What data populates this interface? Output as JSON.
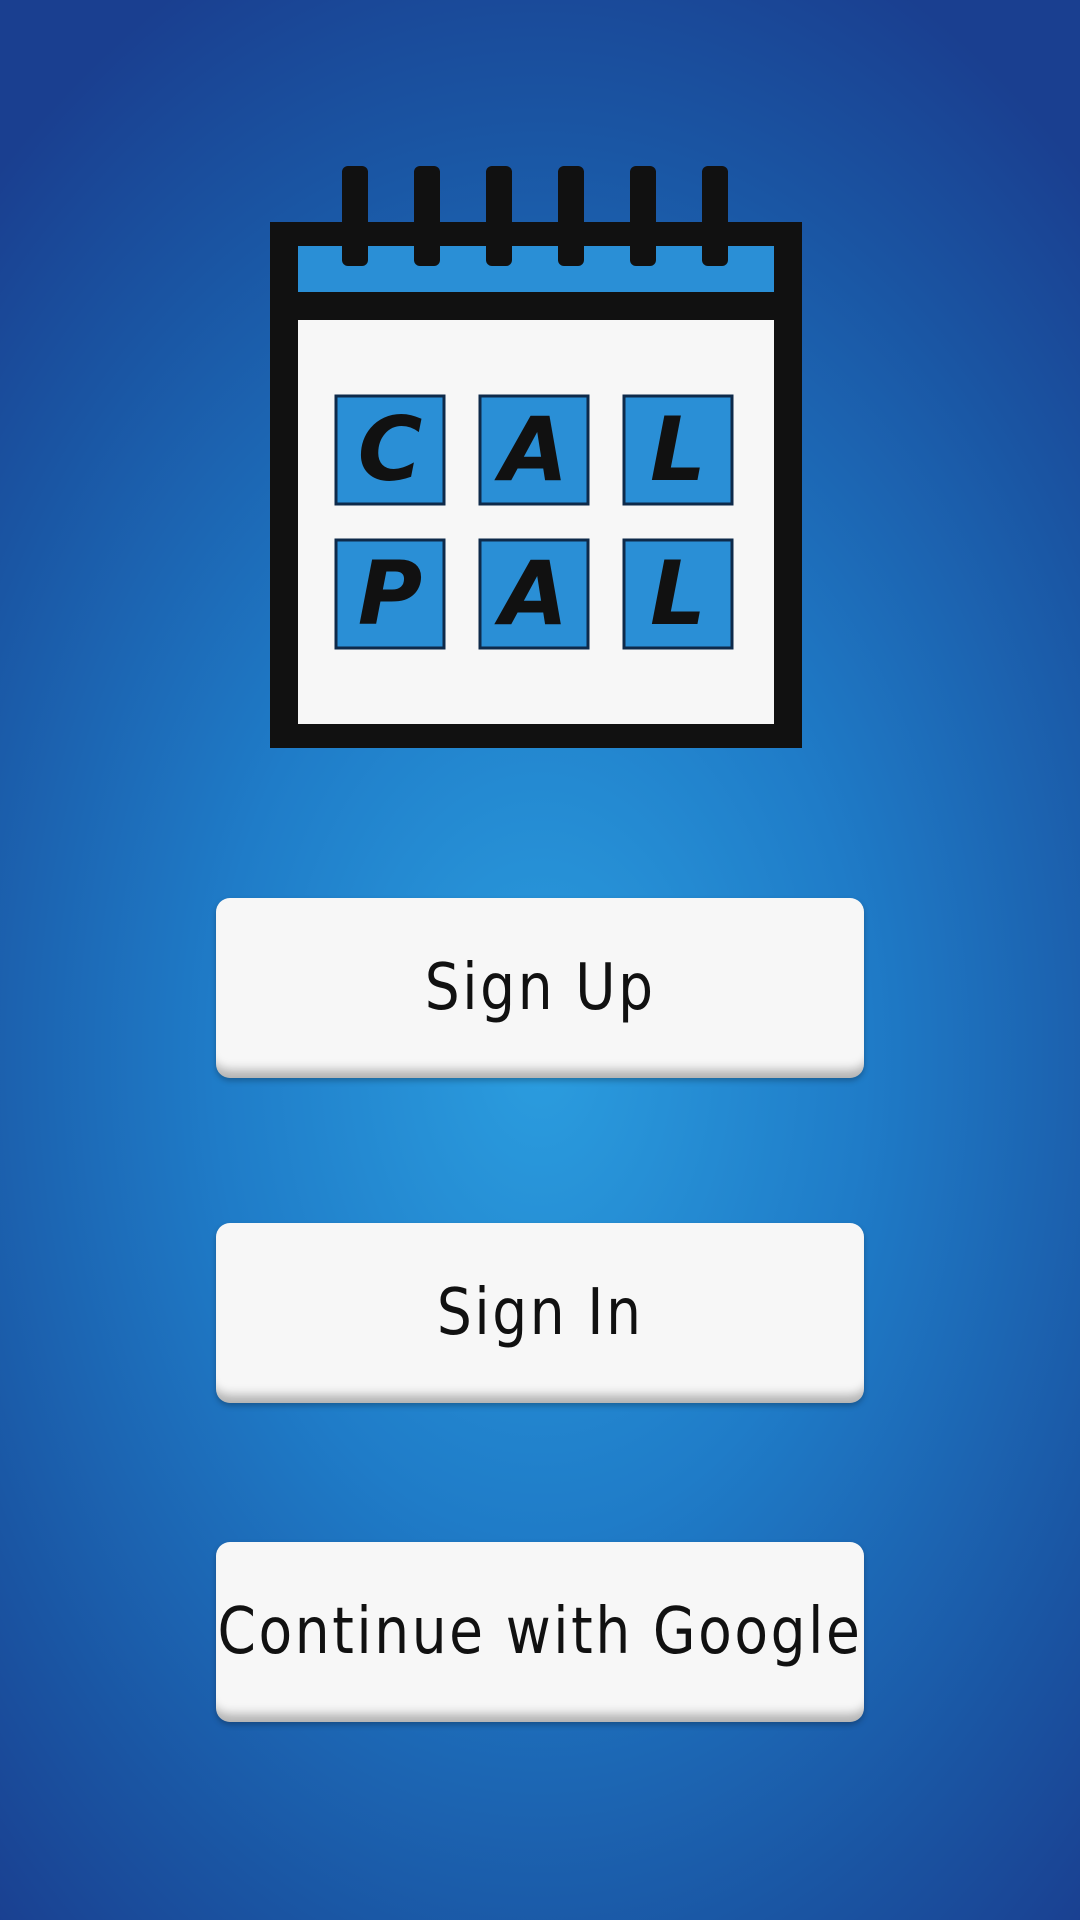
{
  "app": {
    "logo_letters_row1": [
      "C",
      "A",
      "L"
    ],
    "logo_letters_row2": [
      "P",
      "A",
      "L"
    ],
    "logo_icon": "calendar-icon"
  },
  "colors": {
    "background_center": "#2b9ddf",
    "background_edge": "#1a3f90",
    "calendar_header": "#2a8fd6",
    "tile": "#2a8fd6",
    "button_bg": "#f7f7f7",
    "text": "#111111"
  },
  "buttons": {
    "sign_up_label": "Sign Up",
    "sign_in_label": "Sign In",
    "google_label": "Continue with Google"
  }
}
